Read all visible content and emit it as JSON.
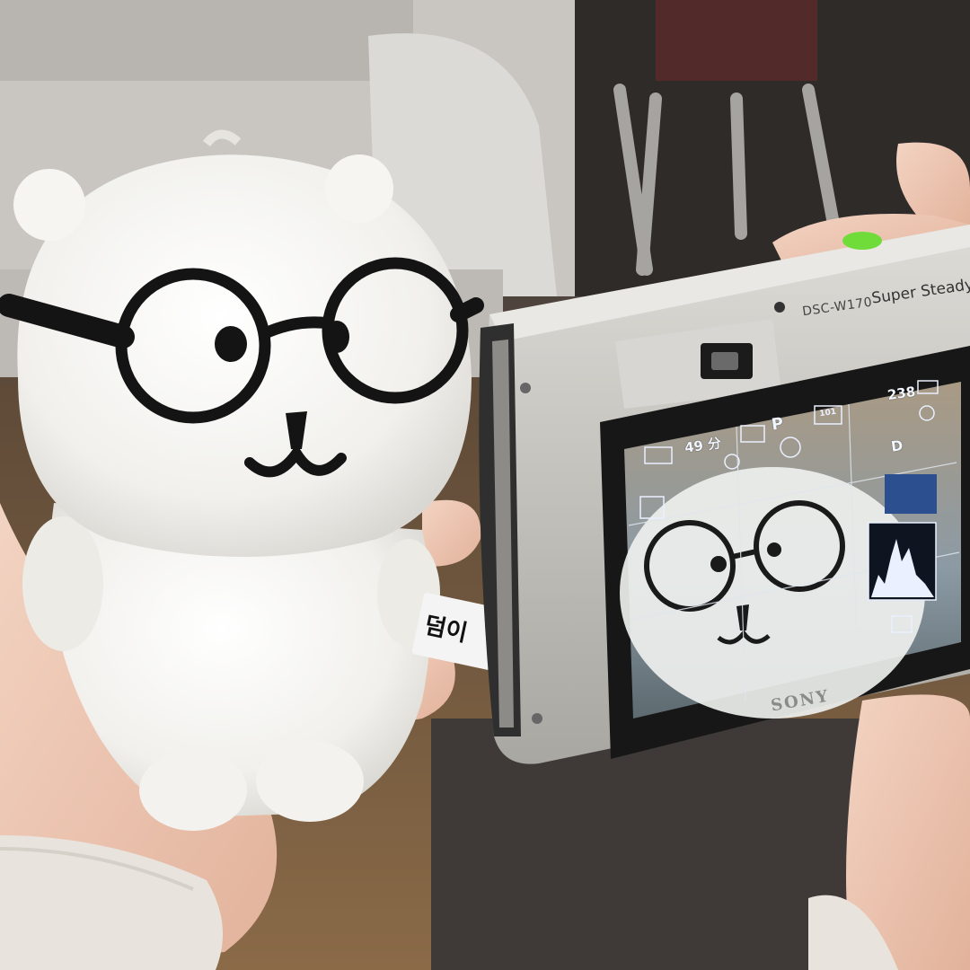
{
  "tag_text": "덤이",
  "camera": {
    "model": "DSC-W170",
    "steady_label": "Super SteadyS",
    "brand": "SONY"
  },
  "lcd": {
    "shots_remaining": "238",
    "record_time": "49 分",
    "mode": "P",
    "folder": "101",
    "dro_label": "D",
    "histogram_shown": true,
    "grid_shown": true
  },
  "colors": {
    "camera_body": "#c9c7c2",
    "plush": "#f6f5f1",
    "glasses": "#141414",
    "lcd_overlay": "#eaf0ff"
  }
}
